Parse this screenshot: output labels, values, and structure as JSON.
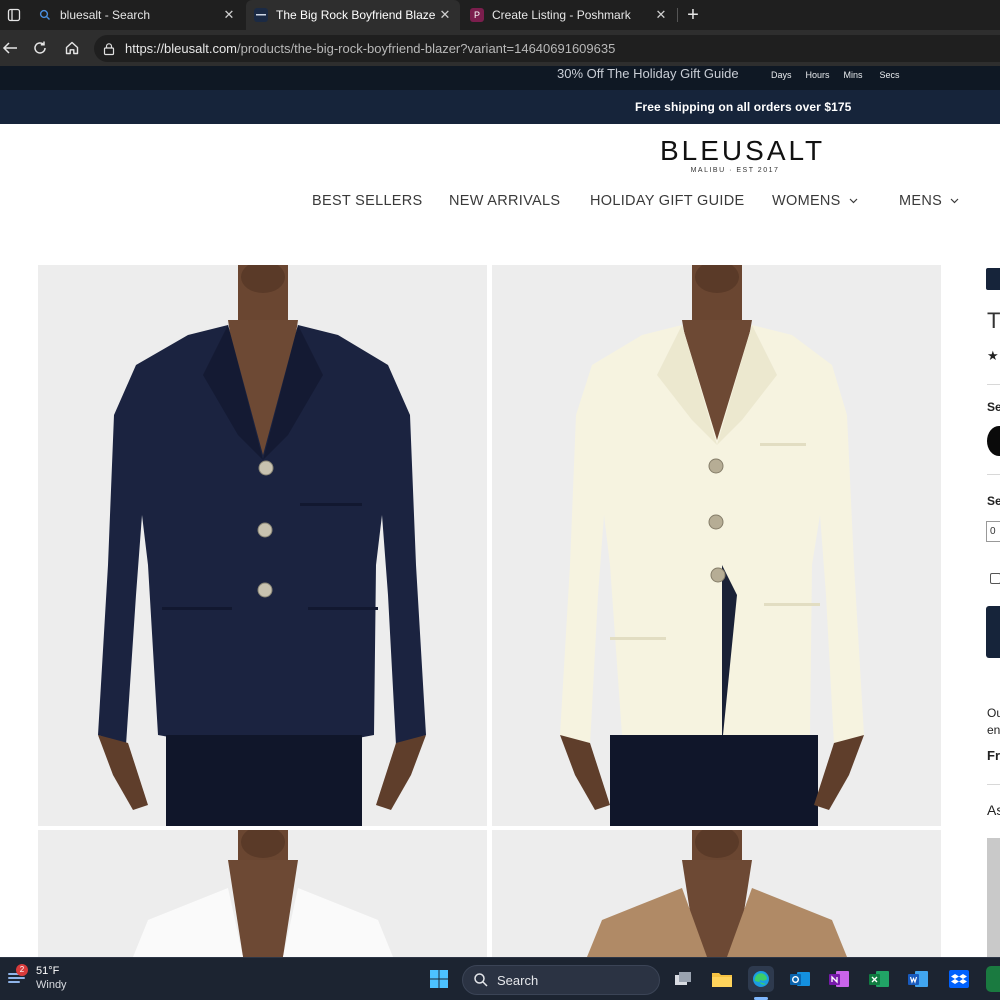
{
  "browser": {
    "tabs": [
      {
        "title": "bluesalt - Search",
        "active": false
      },
      {
        "title": "The Big Rock Boyfriend Blazer | By",
        "active": true
      },
      {
        "title": "Create Listing - Poshmark",
        "active": false
      }
    ],
    "url": {
      "host": "https://bleusalt.com",
      "path": "/products/the-big-rock-boyfriend-blazer?variant=14640691609635"
    }
  },
  "promo": {
    "countdown_text": "30% Off The Holiday Gift Guide",
    "units": [
      "Days",
      "Hours",
      "Mins",
      "Secs"
    ],
    "shipping": "Free shipping on all orders over $175"
  },
  "header": {
    "logo": "BLEUSALT",
    "tagline": "MALIBU · EST 2017",
    "nav": [
      {
        "label": "BEST SELLERS",
        "has_dropdown": false
      },
      {
        "label": "NEW ARRIVALS",
        "has_dropdown": false
      },
      {
        "label": "HOLIDAY GIFT GUIDE",
        "has_dropdown": false
      },
      {
        "label": "WOMENS",
        "has_dropdown": true
      },
      {
        "label": "MENS",
        "has_dropdown": true
      }
    ]
  },
  "gallery": {
    "images": [
      {
        "name": "navy-blazer-photo",
        "color": "#1b2340"
      },
      {
        "name": "cream-blazer-photo",
        "color": "#f6f3e0"
      },
      {
        "name": "white-blazer-photo",
        "color": "#fafafa"
      },
      {
        "name": "camel-blazer-photo",
        "color": "#b08a66"
      }
    ]
  },
  "side_panel": {
    "title_fragment": "T",
    "rating_fragment": "★",
    "select_fragment_1": "Se",
    "select_fragment_2": "Se",
    "size_fragment": "0",
    "note_fragment_1": "Ou",
    "note_fragment_2": "en",
    "bold_fragment": "Fr",
    "ask_fragment": "As"
  },
  "taskbar": {
    "weather": {
      "temp": "51°F",
      "condition": "Windy",
      "alerts": "2"
    },
    "search_label": "Search"
  },
  "colors": {
    "promo_dark": "#0f1824",
    "promo_navy": "#16243a",
    "photo_bg": "#ededed"
  }
}
